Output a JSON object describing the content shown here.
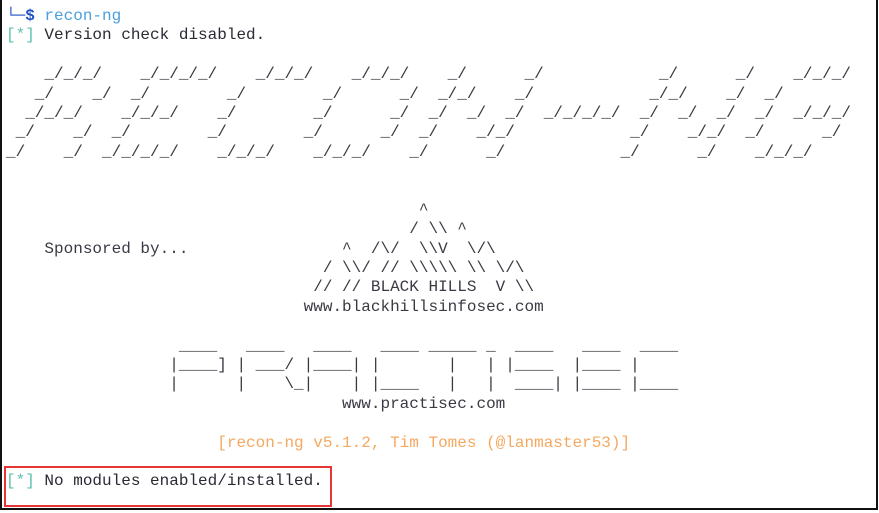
{
  "prompt": {
    "glyph": "└─",
    "symbol": "$",
    "command": "recon-ng"
  },
  "messages": {
    "version_check": {
      "marker": "[*]",
      "text": " Version check disabled."
    },
    "no_modules": {
      "marker": "[*]",
      "text": " No modules enabled/installed."
    }
  },
  "banner": {
    "recon_ng_art": [
      "    _/_/_/    _/_/_/_/    _/_/_/    _/_/_/    _/      _/            _/      _/    _/_/_/",
      "   _/    _/  _/        _/        _/      _/  _/_/    _/            _/_/    _/  _/",
      "  _/_/_/    _/_/_/    _/        _/      _/  _/  _/  _/  _/_/_/_/  _/  _/  _/  _/  _/_/_/",
      " _/    _/  _/        _/        _/      _/  _/    _/_/            _/    _/_/  _/      _/",
      "_/    _/  _/_/_/_/    _/_/_/    _/_/_/    _/      _/            _/      _/    _/_/_/"
    ],
    "sponsor_art": [
      "                                           ^",
      "                                          / \\\\ ^",
      "    Sponsored by...                ^  /\\/  \\\\V  \\/\\",
      "                                 / \\\\/ // \\\\\\\\\\ \\\\ \\/\\",
      "                                // // BLACK HILLS  V \\\\",
      "                               www.blackhillsinfosec.com"
    ],
    "practisec_art": [
      "                  ____   ____   ____   ____ _____ _  ____   ____  ____",
      "                 |____] | ___/ |____| |       |   | |____  |____ |",
      "                 |      |    \\_|    | |____   |   |  ____| |____ |____",
      "                                   www.practisec.com"
    ],
    "version_line": "                      [recon-ng v5.1.2, Tim Tomes (@lanmaster53)]"
  },
  "colors": {
    "prompt": "#2050c8",
    "command": "#4aa0dc",
    "marker": "#5fc0b0",
    "version_line": "#f5a860",
    "highlight_box": "#e53535"
  }
}
